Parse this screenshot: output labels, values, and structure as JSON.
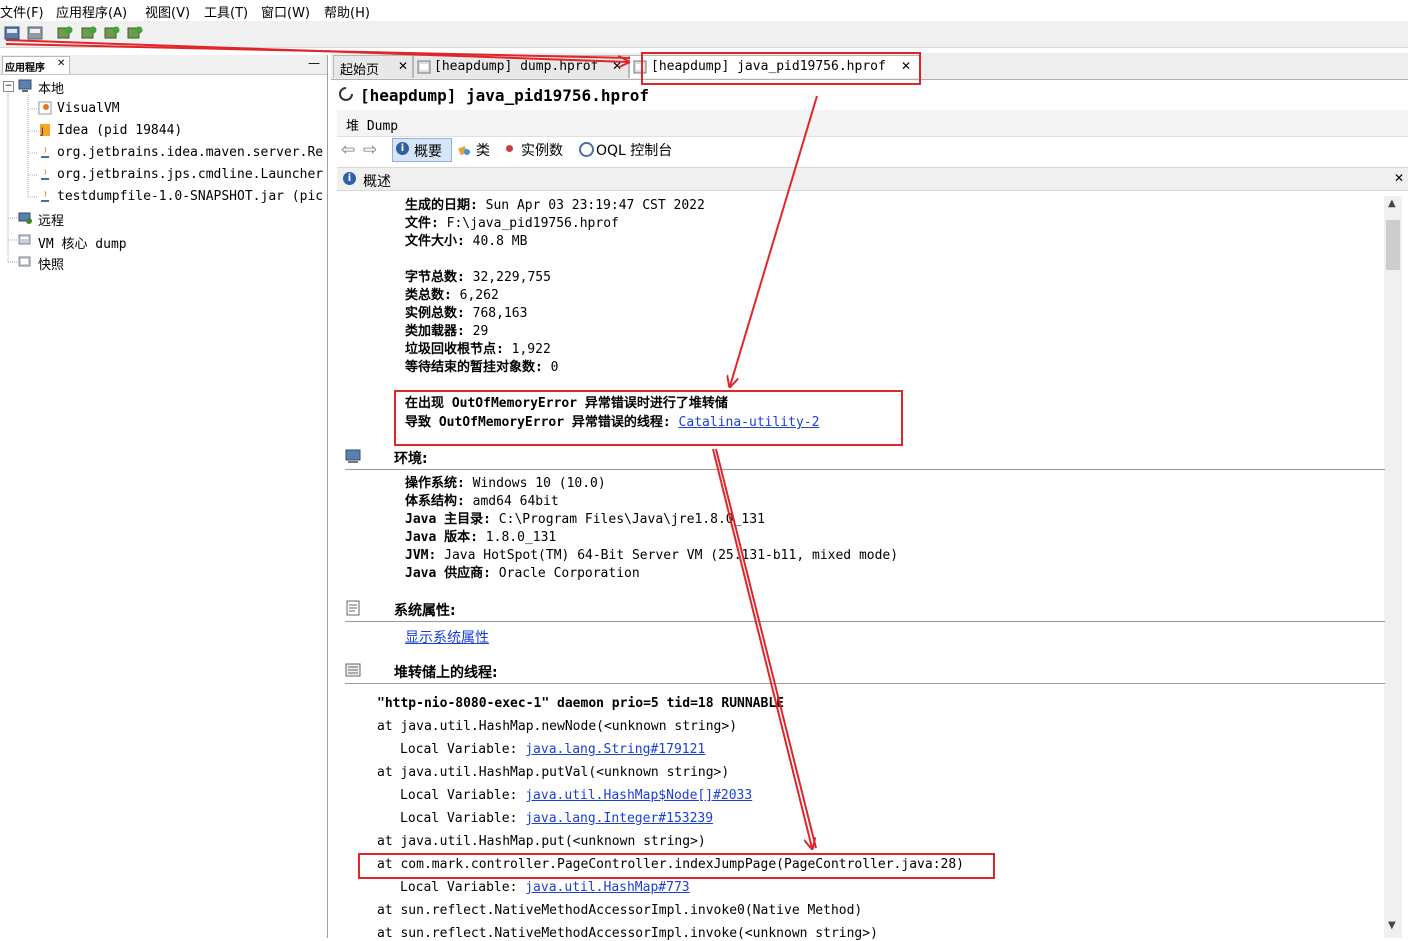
{
  "menu": [
    "文件(F)",
    "应用程序(A)",
    "视图(V)",
    "工具(T)",
    "窗口(W)",
    "帮助(H)"
  ],
  "left_panel": {
    "tab_label": "应用程序",
    "minimize": "—",
    "tree": [
      {
        "label": "本地",
        "icon": "computer-icon"
      },
      {
        "label": "VisualVM",
        "icon": "visualvm-icon"
      },
      {
        "label": "Idea (pid 19844)",
        "icon": "idea-icon"
      },
      {
        "label": "org.jetbrains.idea.maven.server.Re",
        "icon": "java-icon"
      },
      {
        "label": "org.jetbrains.jps.cmdline.Launcher",
        "icon": "java-icon"
      },
      {
        "label": "testdumpfile-1.0-SNAPSHOT.jar (pic",
        "icon": "java-icon"
      },
      {
        "label": "远程",
        "icon": "remote-icon"
      },
      {
        "label": "VM 核心 dump",
        "icon": "coredump-icon"
      },
      {
        "label": "快照",
        "icon": "snapshot-icon"
      }
    ]
  },
  "tabs": [
    {
      "label": "起始页",
      "close": "✕"
    },
    {
      "label": "[heapdump] dump.hprof",
      "close": "✕"
    },
    {
      "label": "[heapdump] java_pid19756.hprof",
      "close": "✕"
    }
  ],
  "document": {
    "title": "[heapdump] java_pid19756.hprof",
    "sub_title": "堆 Dump",
    "subtabs": [
      "概要",
      "类",
      "实例数",
      "OQL 控制台"
    ],
    "overview_label": "概述",
    "close": "✕"
  },
  "summary": [
    {
      "label": "生成的日期:",
      "value": "Sun Apr 03 23:19:47 CST 2022"
    },
    {
      "label": "文件:",
      "value": "F:\\java_pid19756.hprof"
    },
    {
      "label": "文件大小:",
      "value": "40.8 MB"
    },
    {
      "label": "字节总数:",
      "value": "32,229,755"
    },
    {
      "label": "类总数:",
      "value": "6,262"
    },
    {
      "label": "实例总数:",
      "value": "768,163"
    },
    {
      "label": "类加载器:",
      "value": "29"
    },
    {
      "label": "垃圾回收根节点:",
      "value": "1,922"
    },
    {
      "label": "等待结束的暂挂对象数:",
      "value": "0"
    }
  ],
  "oom": {
    "line1": "在出现 OutOfMemoryError 异常错误时进行了堆转储",
    "line2_label": "导致 OutOfMemoryError 异常错误的线程:",
    "line2_link": "Catalina-utility-2"
  },
  "environment": {
    "title": "环境:",
    "rows": [
      {
        "label": "操作系统:",
        "value": "Windows 10 (10.0)"
      },
      {
        "label": "体系结构:",
        "value": "amd64 64bit"
      },
      {
        "label": "Java 主目录:",
        "value": "C:\\Program Files\\Java\\jre1.8.0_131"
      },
      {
        "label": "Java 版本:",
        "value": "1.8.0_131"
      },
      {
        "label": "JVM:",
        "value": "Java HotSpot(TM) 64-Bit Server VM (25.131-b11, mixed mode)"
      },
      {
        "label": "Java 供应商:",
        "value": "Oracle Corporation"
      }
    ]
  },
  "sysprops": {
    "title": "系统属性:",
    "link": "显示系统属性"
  },
  "threads": {
    "title": "堆转储上的线程:",
    "header": "\"http-nio-8080-exec-1\" daemon prio=5 tid=18 RUNNABLE",
    "lines": [
      {
        "kind": "at",
        "text": "at java.util.HashMap.newNode(<unknown string>)"
      },
      {
        "kind": "local",
        "prefix": "Local Variable:",
        "link": "java.lang.String#179121"
      },
      {
        "kind": "at",
        "text": "at java.util.HashMap.putVal(<unknown string>)"
      },
      {
        "kind": "local",
        "prefix": "Local Variable:",
        "link": "java.util.HashMap$Node[]#2033"
      },
      {
        "kind": "local",
        "prefix": "Local Variable:",
        "link": "java.lang.Integer#153239"
      },
      {
        "kind": "at",
        "text": "at java.util.HashMap.put(<unknown string>)"
      },
      {
        "kind": "at",
        "text": "at com.mark.controller.PageController.indexJumpPage(PageController.java:28)"
      },
      {
        "kind": "local",
        "prefix": "Local Variable:",
        "link": "java.util.HashMap#773"
      },
      {
        "kind": "at",
        "text": "at sun.reflect.NativeMethodAccessorImpl.invoke0(Native Method)"
      },
      {
        "kind": "at",
        "text": "at sun.reflect.NativeMethodAccessorImpl.invoke(<unknown string>)"
      }
    ]
  },
  "colors": {
    "annotation": "#e0262a",
    "link": "#1a3fd6",
    "selected_tab": "#d6e6f8"
  }
}
